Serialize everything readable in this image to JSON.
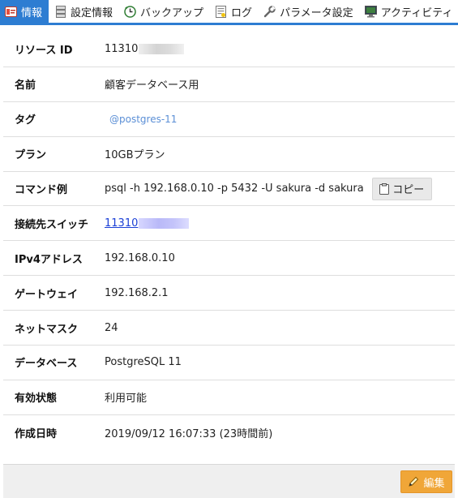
{
  "tabs": [
    {
      "label": "情報",
      "icon": "info-card-icon"
    },
    {
      "label": "設定情報",
      "icon": "server-stack-icon"
    },
    {
      "label": "バックアップ",
      "icon": "backup-clock-icon"
    },
    {
      "label": "ログ",
      "icon": "log-document-icon"
    },
    {
      "label": "パラメータ設定",
      "icon": "wrench-icon"
    },
    {
      "label": "アクティビティ",
      "icon": "monitor-icon"
    }
  ],
  "active_tab": "情報",
  "colors": {
    "tab_active": "#2d7dd2",
    "link": "#1a3fd6",
    "tag": "#5b8fd6",
    "edit_button": "#f0a638"
  },
  "details": {
    "resource_id": {
      "label": "リソース ID",
      "value": "11310"
    },
    "name": {
      "label": "名前",
      "value": "顧客データベース用"
    },
    "tag": {
      "label": "タグ",
      "value": "@postgres-11"
    },
    "plan": {
      "label": "プラン",
      "value": "10GBプラン"
    },
    "command": {
      "label": "コマンド例",
      "value": "psql -h 192.168.0.10 -p 5432 -U sakura -d sakura",
      "copy_label": "コピー"
    },
    "switch": {
      "label": "接続先スイッチ",
      "value": "11310"
    },
    "ipv4": {
      "label": "IPv4アドレス",
      "value": "192.168.0.10"
    },
    "gateway": {
      "label": "ゲートウェイ",
      "value": "192.168.2.1"
    },
    "netmask": {
      "label": "ネットマスク",
      "value": "24"
    },
    "database": {
      "label": "データベース",
      "value": "PostgreSQL 11"
    },
    "status": {
      "label": "有効状態",
      "value": "利用可能"
    },
    "created": {
      "label": "作成日時",
      "value": "2019/09/12 16:07:33 (23時間前)"
    }
  },
  "footer": {
    "edit_label": "編集"
  }
}
